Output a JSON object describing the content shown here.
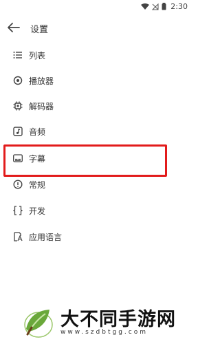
{
  "status_bar": {
    "time": "2:30",
    "icons": [
      "wifi-icon",
      "signal-off-icon",
      "battery-icon"
    ]
  },
  "app_bar": {
    "title": "设置",
    "back_icon": "arrow-left-icon"
  },
  "menu": {
    "items": [
      {
        "label": "列表",
        "icon": "list-icon"
      },
      {
        "label": "播放器",
        "icon": "player-icon"
      },
      {
        "label": "解码器",
        "icon": "chip-icon"
      },
      {
        "label": "音频",
        "icon": "audio-icon"
      },
      {
        "label": "字幕",
        "icon": "subtitles-icon"
      },
      {
        "label": "常规",
        "icon": "info-icon"
      },
      {
        "label": "开发",
        "icon": "code-icon"
      },
      {
        "label": "应用语言",
        "icon": "language-icon"
      }
    ],
    "highlighted_item": "字幕"
  },
  "watermark": {
    "text": "大不同手游网",
    "url": "www.szdbtgg.com"
  },
  "colors": {
    "highlight": "#e21b1b",
    "text": "#333333",
    "logo_green": "#6aa83a"
  }
}
